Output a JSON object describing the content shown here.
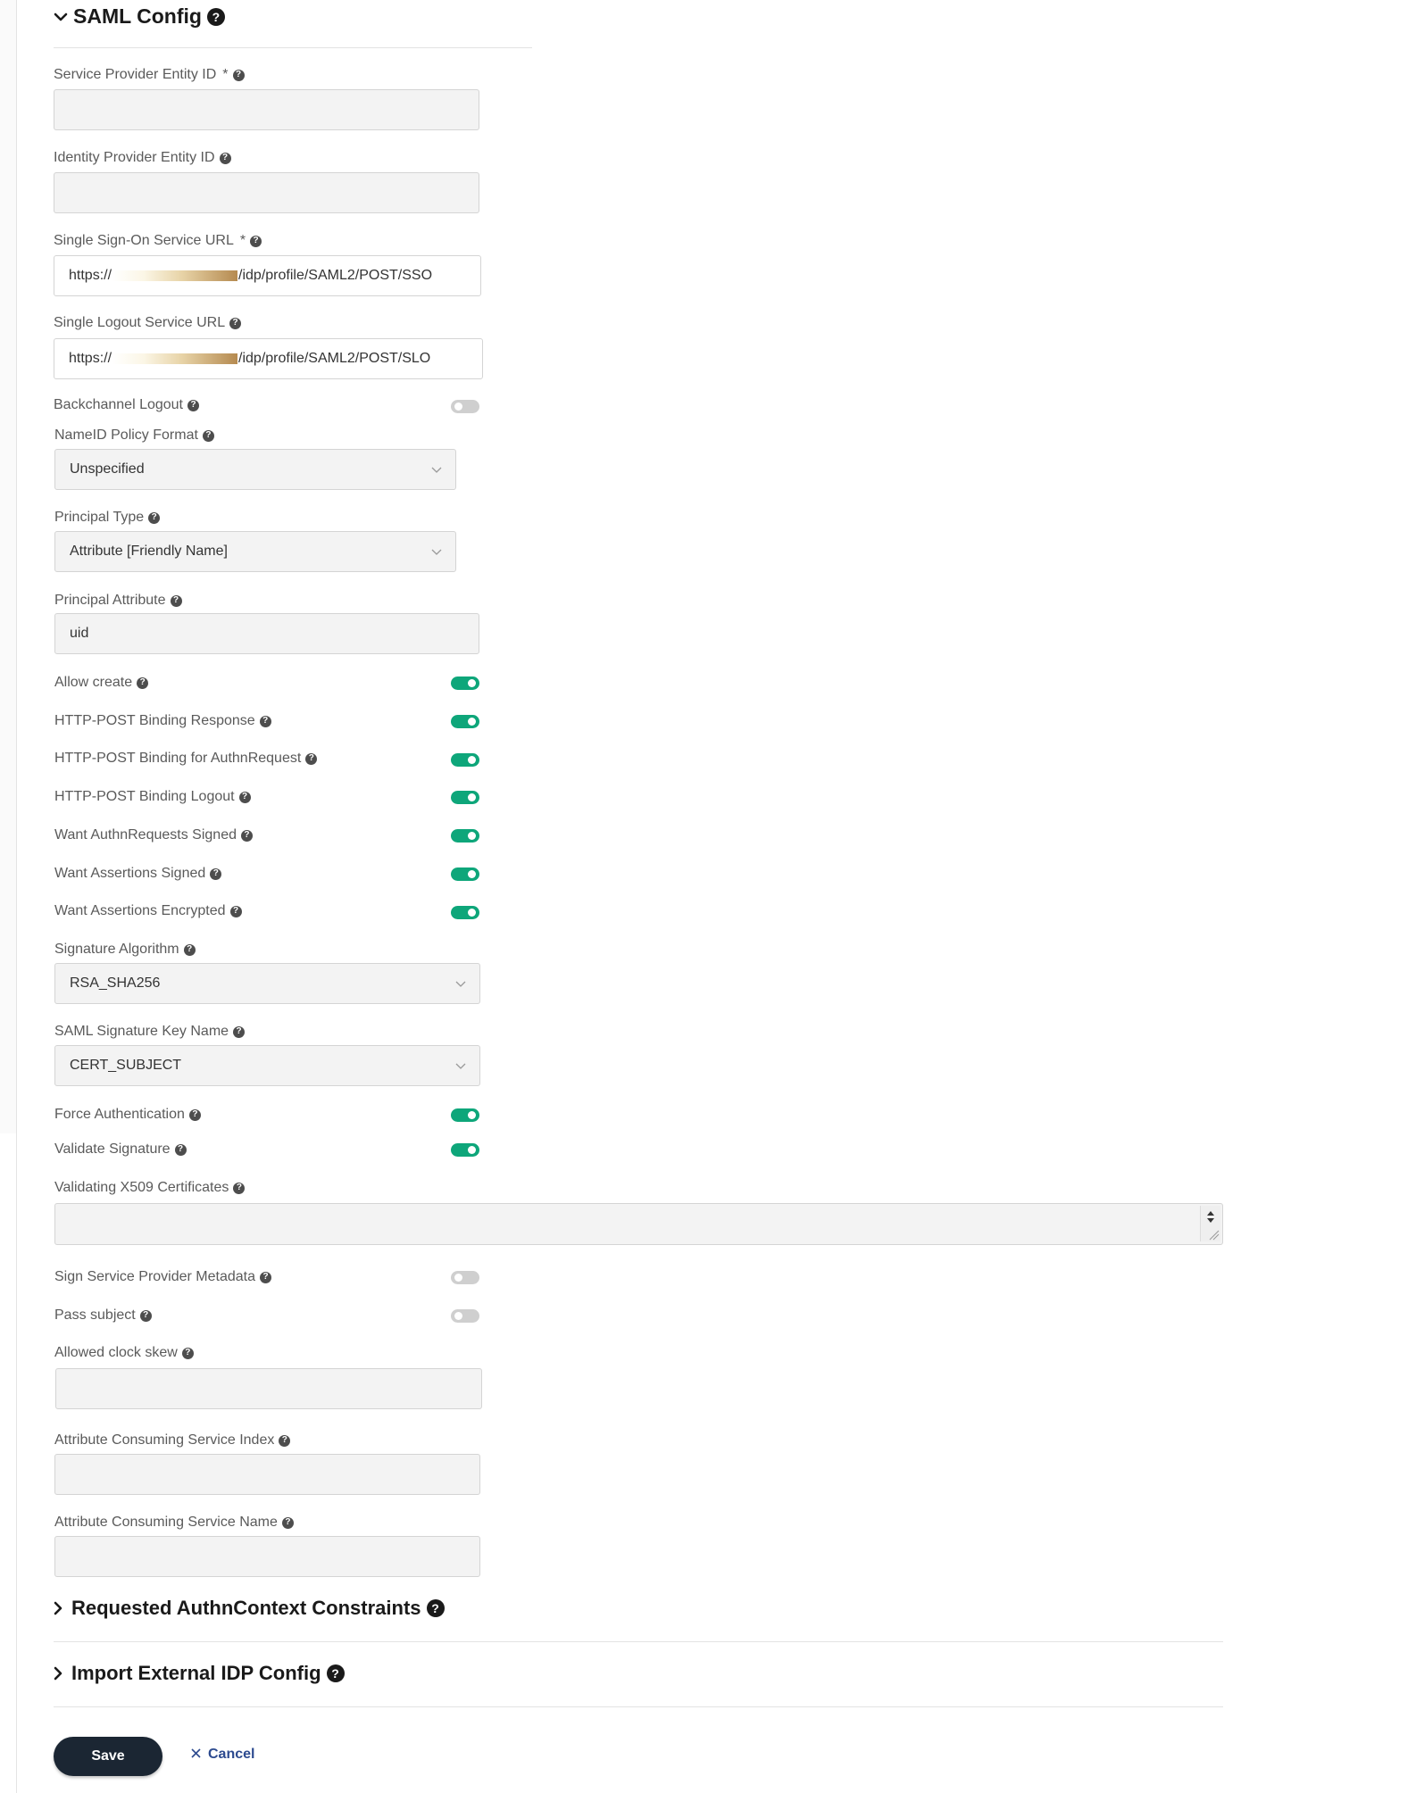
{
  "saml_config": {
    "title": "SAML Config",
    "fields": {
      "sp_entity_id": {
        "label": "Service Provider Entity ID",
        "required": "*",
        "value": ""
      },
      "idp_entity_id": {
        "label": "Identity Provider Entity ID",
        "value": ""
      },
      "sso_url": {
        "label": "Single Sign-On Service URL",
        "required": "*",
        "value_prefix": "https://",
        "value_suffix": "/idp/profile/SAML2/POST/SSO"
      },
      "slo_url": {
        "label": "Single Logout Service URL",
        "value_prefix": "https://",
        "value_suffix": "/idp/profile/SAML2/POST/SLO"
      },
      "backchannel_logout": {
        "label": "Backchannel Logout",
        "enabled": false
      },
      "nameid_policy_format": {
        "label": "NameID Policy Format",
        "value": "Unspecified"
      },
      "principal_type": {
        "label": "Principal Type",
        "value": "Attribute [Friendly Name]"
      },
      "principal_attribute": {
        "label": "Principal Attribute",
        "value": "uid"
      },
      "allow_create": {
        "label": "Allow create",
        "enabled": true
      },
      "http_post_binding_response": {
        "label": "HTTP-POST Binding Response",
        "enabled": true
      },
      "http_post_binding_authn": {
        "label": "HTTP-POST Binding for AuthnRequest",
        "enabled": true
      },
      "http_post_binding_logout": {
        "label": "HTTP-POST Binding Logout",
        "enabled": true
      },
      "want_authn_signed": {
        "label": "Want AuthnRequests Signed",
        "enabled": true
      },
      "want_assertions_signed": {
        "label": "Want Assertions Signed",
        "enabled": true
      },
      "want_assertions_encrypted": {
        "label": "Want Assertions Encrypted",
        "enabled": true
      },
      "signature_algorithm": {
        "label": "Signature Algorithm",
        "value": "RSA_SHA256"
      },
      "saml_sig_key_name": {
        "label": "SAML Signature Key Name",
        "value": "CERT_SUBJECT"
      },
      "force_authentication": {
        "label": "Force Authentication",
        "enabled": true
      },
      "validate_signature": {
        "label": "Validate Signature",
        "enabled": true
      },
      "validating_x509": {
        "label": "Validating X509 Certificates",
        "value": ""
      },
      "sign_sp_metadata": {
        "label": "Sign Service Provider Metadata",
        "enabled": false
      },
      "pass_subject": {
        "label": "Pass subject",
        "enabled": false
      },
      "allowed_clock_skew": {
        "label": "Allowed clock skew",
        "value": ""
      },
      "acs_index": {
        "label": "Attribute Consuming Service Index",
        "value": ""
      },
      "acs_name": {
        "label": "Attribute Consuming Service Name",
        "value": ""
      }
    }
  },
  "requested_authn_context": {
    "title": "Requested AuthnContext Constraints"
  },
  "import_external_idp": {
    "title": "Import External IDP Config"
  },
  "actions": {
    "save_label": "Save",
    "cancel_label": "Cancel"
  },
  "colors": {
    "toggle_on": "#0ea67a",
    "toggle_off": "#cfcfcf",
    "save_bg": "#1b2633",
    "cancel_text": "#2c4a8f"
  },
  "icons": {
    "help": "question-circle-icon",
    "expanded": "chevron-down-icon",
    "collapsed": "chevron-right-icon",
    "select": "chevron-down-icon",
    "cancel": "close-icon"
  }
}
